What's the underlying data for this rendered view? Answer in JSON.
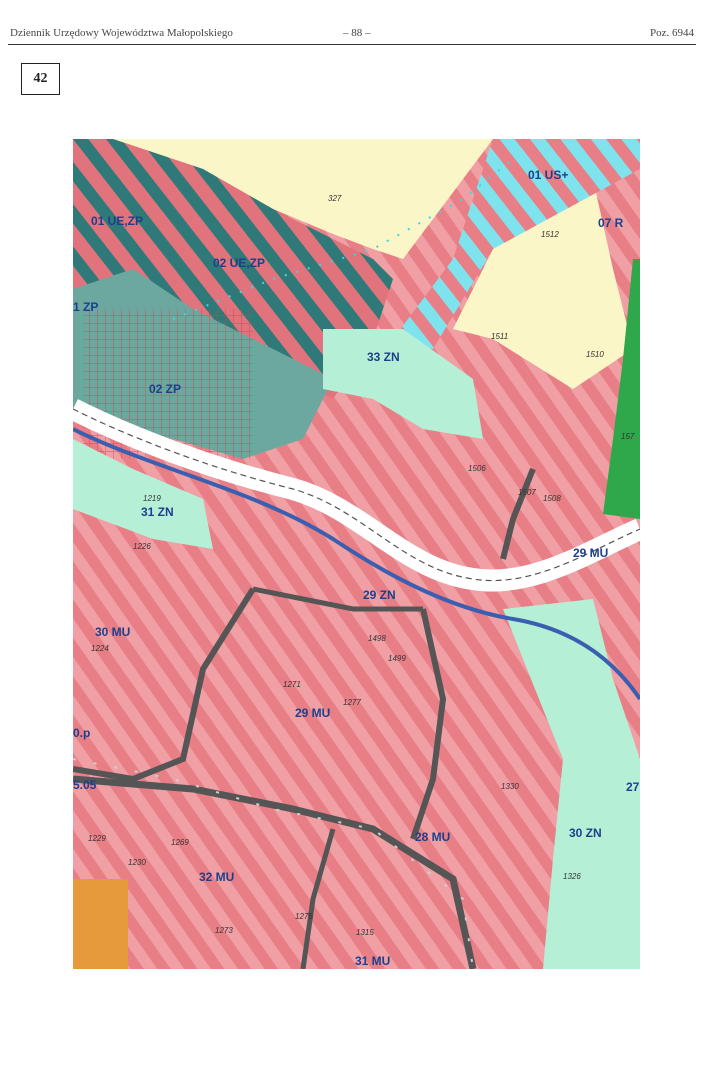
{
  "header": {
    "left": "Dziennik Urzędowy Województwa Małopolskiego",
    "center": "– 88 –",
    "right": "Poz. 6944"
  },
  "attachment_number": "42",
  "map": {
    "zone_labels": [
      "01 US+",
      "07 R",
      "01 UE,ZP",
      "02 UE,ZP",
      "1 ZP",
      "02 ZP",
      "33 ZN",
      "31 ZN",
      "29 MU",
      "29 ZN",
      "30 MU",
      "29 MU",
      "28 MU",
      "30 ZN",
      "32 MU",
      "31 MU",
      "0.p",
      "5.05",
      "27"
    ],
    "parcel_labels": [
      "327",
      "1512",
      "1511",
      "1510",
      "1219",
      "1271",
      "1277",
      "1330",
      "1229",
      "1230",
      "1269",
      "1275",
      "1315",
      "1326",
      "1498",
      "1499",
      "1506",
      "1507",
      "1508",
      "1273",
      "1224",
      "1226",
      "157"
    ],
    "colors": {
      "residential": "#e87e86",
      "stripe_light": "#f0a0a5",
      "agricultural": "#fbf6c8",
      "green_zn": "#b5f0d6",
      "green_zp": "#6da8a0",
      "teal_stripe": "#2f7a78",
      "sport_cyan": "#7fe3ee",
      "road_gray": "#555555",
      "forest": "#2ea84a",
      "orange_block": "#e79a3c",
      "zone_text": "#1d3f8c"
    }
  }
}
